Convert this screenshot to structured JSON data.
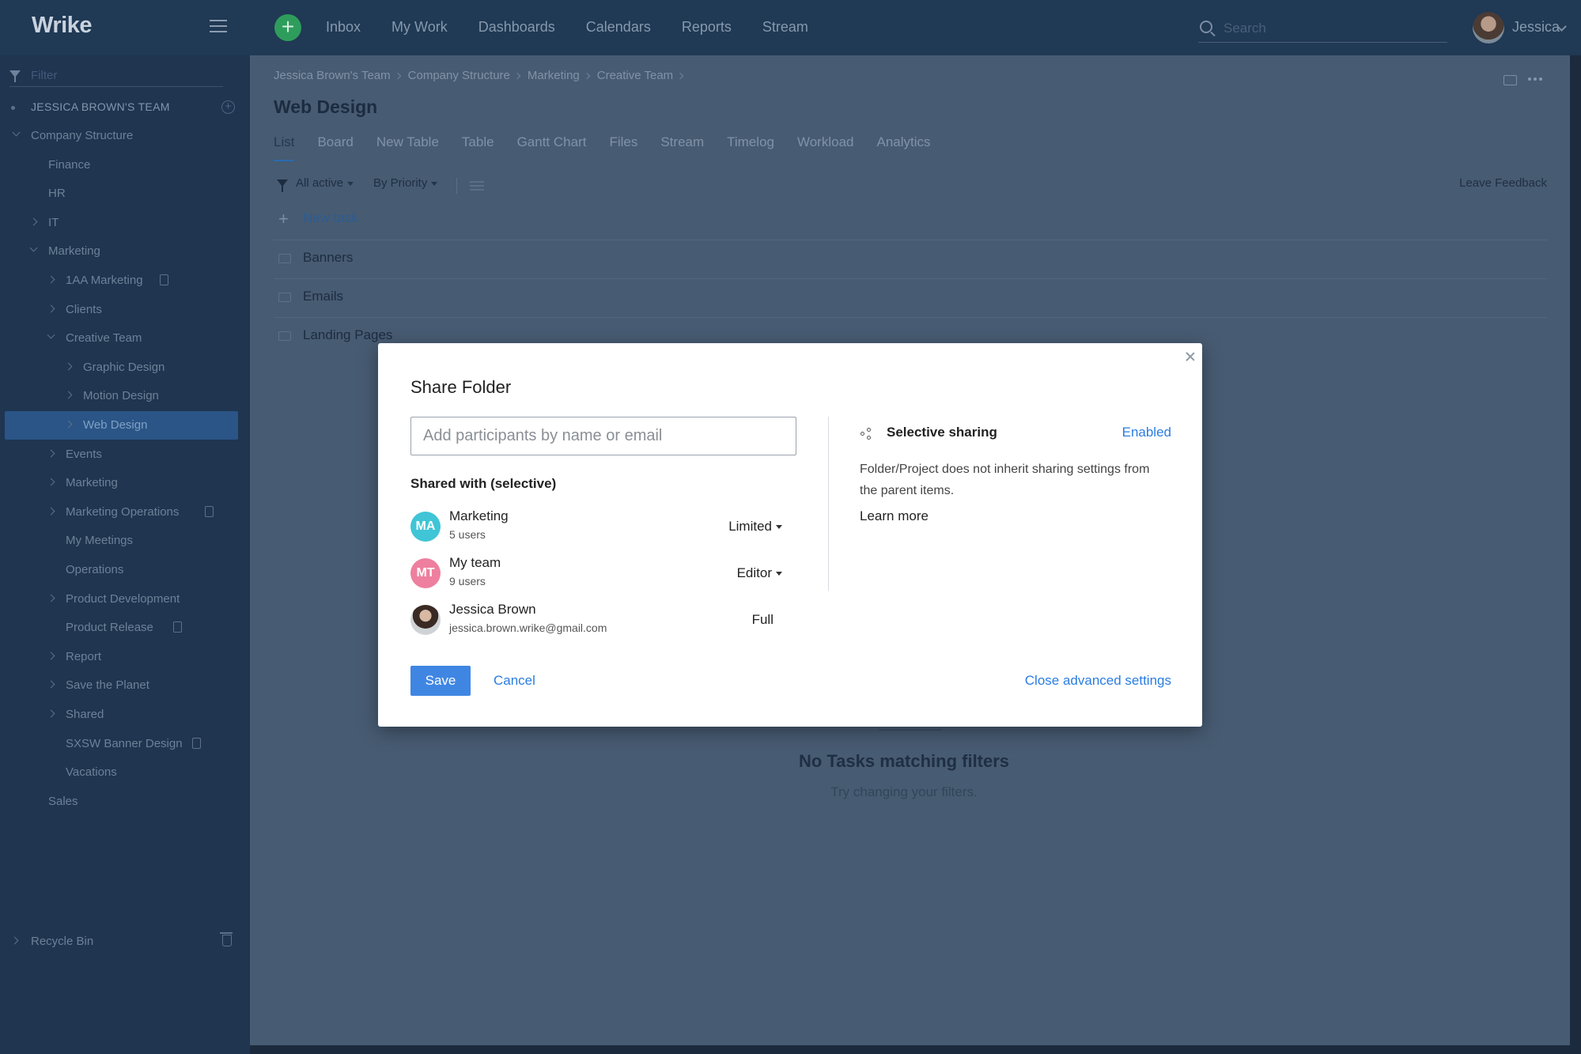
{
  "app": {
    "logo": "Wrike"
  },
  "topnav": {
    "items": [
      "Inbox",
      "My Work",
      "Dashboards",
      "Calendars",
      "Reports",
      "Stream"
    ],
    "search_placeholder": "Search",
    "user_name": "Jessica"
  },
  "sidebar": {
    "filter_placeholder": "Filter",
    "team": "JESSICA BROWN'S TEAM",
    "items": [
      {
        "label": "Company Structure",
        "level": 0,
        "chevron": "down"
      },
      {
        "label": "Finance",
        "level": 1,
        "chevron": ""
      },
      {
        "label": "HR",
        "level": 1,
        "chevron": ""
      },
      {
        "label": "IT",
        "level": 1,
        "chevron": "right"
      },
      {
        "label": "Marketing",
        "level": 1,
        "chevron": "down"
      },
      {
        "label": "1AA Marketing",
        "level": 2,
        "chevron": "right",
        "doc": true
      },
      {
        "label": "Clients",
        "level": 2,
        "chevron": "right"
      },
      {
        "label": "Creative Team",
        "level": 2,
        "chevron": "down"
      },
      {
        "label": "Graphic Design",
        "level": 3,
        "chevron": "right"
      },
      {
        "label": "Motion Design",
        "level": 3,
        "chevron": "right"
      },
      {
        "label": "Web Design",
        "level": 3,
        "chevron": "right",
        "active": true
      },
      {
        "label": "Events",
        "level": 2,
        "chevron": "right"
      },
      {
        "label": "Marketing",
        "level": 2,
        "chevron": "right"
      },
      {
        "label": "Marketing Operations",
        "level": 2,
        "chevron": "right",
        "doc": true
      },
      {
        "label": "My Meetings",
        "level": 2,
        "chevron": ""
      },
      {
        "label": "Operations",
        "level": 2,
        "chevron": ""
      },
      {
        "label": "Product Development",
        "level": 2,
        "chevron": "right"
      },
      {
        "label": "Product Release",
        "level": 2,
        "chevron": "",
        "doc": true
      },
      {
        "label": "Report",
        "level": 2,
        "chevron": "right"
      },
      {
        "label": "Save the Planet",
        "level": 2,
        "chevron": "right"
      },
      {
        "label": "Shared",
        "level": 2,
        "chevron": "right"
      },
      {
        "label": "SXSW Banner Design",
        "level": 2,
        "chevron": "",
        "doc": true
      },
      {
        "label": "Vacations",
        "level": 2,
        "chevron": ""
      },
      {
        "label": "Sales",
        "level": 1,
        "chevron": ""
      }
    ],
    "recycle_bin": "Recycle Bin"
  },
  "main": {
    "breadcrumb": [
      "Jessica Brown's Team",
      "Company Structure",
      "Marketing",
      "Creative Team"
    ],
    "title": "Web Design",
    "tabs": [
      "List",
      "Board",
      "New Table",
      "Table",
      "Gantt Chart",
      "Files",
      "Stream",
      "Timelog",
      "Workload",
      "Analytics"
    ],
    "active_tab": "List",
    "filter_status": "All active",
    "sort": "By Priority",
    "leave_feedback": "Leave Feedback",
    "new_task": "New task",
    "folders": [
      "Banners",
      "Emails",
      "Landing Pages"
    ],
    "empty_title": "No Tasks matching filters",
    "empty_subtitle": "Try changing your filters."
  },
  "dialog": {
    "title": "Share Folder",
    "participants_placeholder": "Add participants by name or email",
    "shared_with_label": "Shared with (selective)",
    "members": [
      {
        "initials": "MA",
        "name": "Marketing",
        "sub": "5 users",
        "role": "Limited",
        "dropdown": true,
        "color": "#3fc5d6"
      },
      {
        "initials": "MT",
        "name": "My team",
        "sub": "9 users",
        "role": "Editor",
        "dropdown": true,
        "color": "#ee7f9e"
      },
      {
        "initials": "",
        "name": "Jessica Brown",
        "sub": "jessica.brown.wrike@gmail.com",
        "role": "Full",
        "dropdown": false,
        "color": ""
      }
    ],
    "selective_title": "Selective sharing",
    "selective_status": "Enabled",
    "selective_description": "Folder/Project does not inherit sharing settings from the parent items.",
    "learn_more": "Learn more",
    "save": "Save",
    "cancel": "Cancel",
    "close_advanced": "Close advanced settings"
  }
}
